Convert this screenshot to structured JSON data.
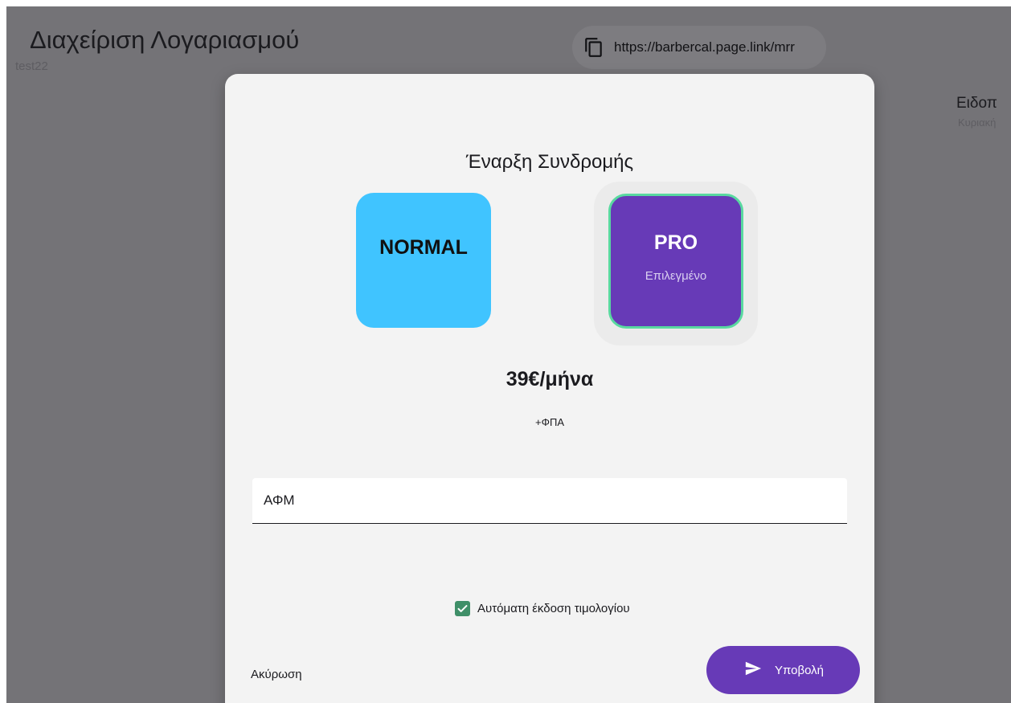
{
  "background": {
    "title": "Διαχείριση Λογαριασμού",
    "subtitle": "test22",
    "link": {
      "icon": "copy-icon",
      "url": "https://barbercal.page.link/mrr"
    },
    "right_panel": {
      "title": "Ειδοπ",
      "subtitle": "Κυριακή"
    }
  },
  "dialog": {
    "title": "Έναρξη Συνδρομής",
    "plans": [
      {
        "name": "NORMAL",
        "status": "",
        "color": "#40c4ff",
        "selected": false
      },
      {
        "name": "PRO",
        "status": "Επιλεγμένο",
        "color": "#673ab7",
        "selected": true
      }
    ],
    "selected_border_color": "#59d9a0",
    "price": "39€/μήνα",
    "vat_note": "+ΦΠΑ",
    "vat_field": {
      "label": "ΑΦΜ",
      "value": ""
    },
    "auto_invoice": {
      "label": "Αυτόματη έκδοση τιμολογίου",
      "checked": true,
      "color": "#3f8f68"
    },
    "cancel_label": "Ακύρωση",
    "submit": {
      "label": "Υποβολή",
      "icon": "send-icon",
      "color": "#673ab7"
    }
  }
}
